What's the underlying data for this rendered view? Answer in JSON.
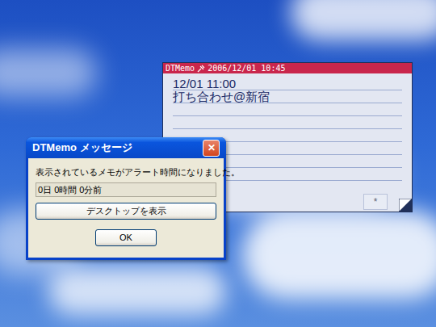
{
  "memo": {
    "title": "DTMemo",
    "timestamp": "2006/12/01 10:45",
    "lines": [
      "12/01 11:00",
      "打ち合わせ@新宿"
    ],
    "footer_button": "*"
  },
  "dialog": {
    "title": "DTMemo メッセージ",
    "close": "✕",
    "message": "表示されているメモがアラート時間になりました。",
    "countdown": "0日 0時間 0分前",
    "buttons": [
      "デスクトップを表示",
      "OK"
    ]
  }
}
